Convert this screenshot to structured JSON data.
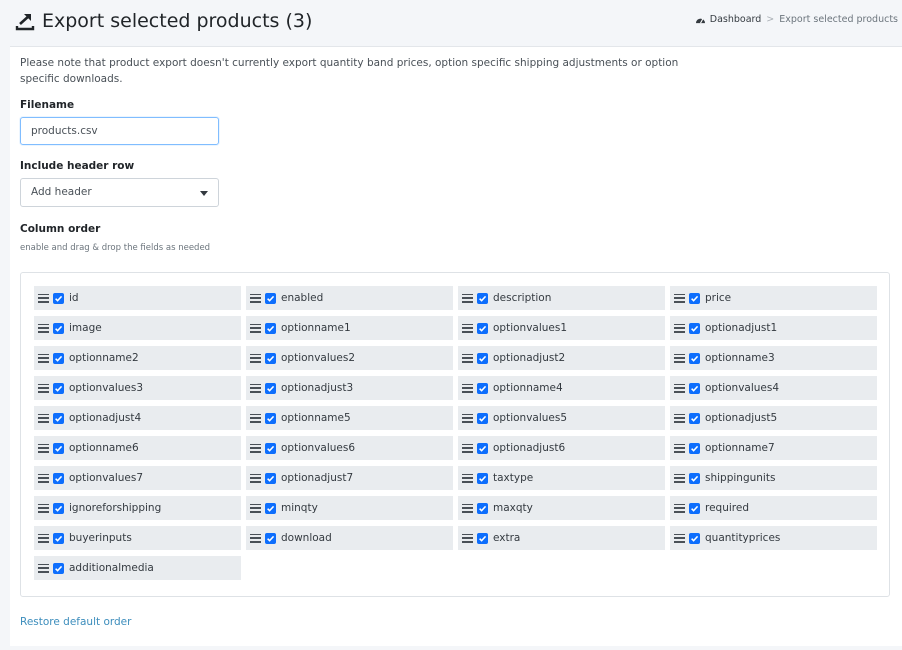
{
  "header": {
    "title": "Export selected products (3)",
    "title_icon": "export-icon"
  },
  "breadcrumb": {
    "home_icon": "dashboard-icon",
    "home": "Dashboard",
    "separator": ">",
    "current": "Export selected products"
  },
  "notice": "Please note that product export doesn't currently export quantity band prices, option specific shipping adjustments or option specific downloads.",
  "filename": {
    "label": "Filename",
    "value": "products.csv"
  },
  "header_row": {
    "label": "Include header row",
    "selected": "Add header"
  },
  "column_order": {
    "label": "Column order",
    "hint": "enable and drag & drop the fields as needed",
    "fields": [
      "id",
      "enabled",
      "description",
      "price",
      "image",
      "optionname1",
      "optionvalues1",
      "optionadjust1",
      "optionname2",
      "optionvalues2",
      "optionadjust2",
      "optionname3",
      "optionvalues3",
      "optionadjust3",
      "optionname4",
      "optionvalues4",
      "optionadjust4",
      "optionname5",
      "optionvalues5",
      "optionadjust5",
      "optionname6",
      "optionvalues6",
      "optionadjust6",
      "optionname7",
      "optionvalues7",
      "optionadjust7",
      "taxtype",
      "shippingunits",
      "ignoreforshipping",
      "minqty",
      "maxqty",
      "required",
      "buyerinputs",
      "download",
      "extra",
      "quantityprices",
      "additionalmedia"
    ]
  },
  "restore_link": "Restore default order",
  "colors": {
    "accent": "#0d6efd",
    "link": "#3c8dbc",
    "field_bg": "#e9ecef"
  }
}
